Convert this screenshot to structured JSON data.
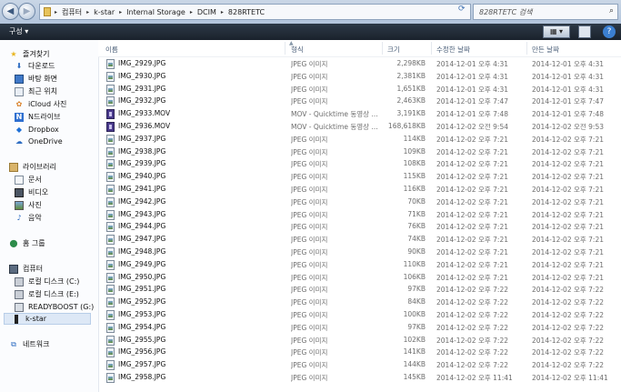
{
  "window": {
    "breadcrumbs": [
      "컴퓨터",
      "k-star",
      "Internal Storage",
      "DCIM",
      "828RTETC"
    ],
    "search_placeholder": "828RTETC 검색"
  },
  "toolbar": {
    "organize_label": "구성 ▾"
  },
  "nav": {
    "favorites": {
      "label": "즐겨찾기",
      "items": [
        "다운로드",
        "바탕 화면",
        "최근 위치",
        "iCloud 사진",
        "N드라이브",
        "Dropbox",
        "OneDrive"
      ]
    },
    "libraries": {
      "label": "라이브러리",
      "items": [
        "문서",
        "비디오",
        "사진",
        "음악"
      ]
    },
    "homegroup": "홈 그룹",
    "computer": {
      "label": "컴퓨터",
      "items": [
        "로컬 디스크 (C:)",
        "로컬 디스크 (E:)",
        "READYBOOST (G:)",
        "k-star"
      ]
    },
    "network": "네트워크"
  },
  "columns": {
    "name": "이름",
    "type": "형식",
    "size": "크기",
    "modified": "수정한 날짜",
    "created": "만든 날짜"
  },
  "files": [
    {
      "name": "IMG_2929.JPG",
      "type": "JPEG 이미지",
      "size": "2,298KB",
      "modified": "2014-12-01 오후 4:31",
      "created": "2014-12-01 오후 4:31",
      "kind": "jpg"
    },
    {
      "name": "IMG_2930.JPG",
      "type": "JPEG 이미지",
      "size": "2,381KB",
      "modified": "2014-12-01 오후 4:31",
      "created": "2014-12-01 오후 4:31",
      "kind": "jpg"
    },
    {
      "name": "IMG_2931.JPG",
      "type": "JPEG 이미지",
      "size": "1,651KB",
      "modified": "2014-12-01 오후 4:31",
      "created": "2014-12-01 오후 4:31",
      "kind": "jpg"
    },
    {
      "name": "IMG_2932.JPG",
      "type": "JPEG 이미지",
      "size": "2,463KB",
      "modified": "2014-12-01 오후 7:47",
      "created": "2014-12-01 오후 7:47",
      "kind": "jpg"
    },
    {
      "name": "IMG_2933.MOV",
      "type": "MOV - Quicktime 동영상 ...",
      "size": "3,191KB",
      "modified": "2014-12-01 오후 7:48",
      "created": "2014-12-01 오후 7:48",
      "kind": "mov"
    },
    {
      "name": "IMG_2936.MOV",
      "type": "MOV - Quicktime 동영상 ...",
      "size": "168,618KB",
      "modified": "2014-12-02 오전 9:54",
      "created": "2014-12-02 오전 9:53",
      "kind": "mov"
    },
    {
      "name": "IMG_2937.JPG",
      "type": "JPEG 이미지",
      "size": "114KB",
      "modified": "2014-12-02 오후 7:21",
      "created": "2014-12-02 오후 7:21",
      "kind": "jpg"
    },
    {
      "name": "IMG_2938.JPG",
      "type": "JPEG 이미지",
      "size": "109KB",
      "modified": "2014-12-02 오후 7:21",
      "created": "2014-12-02 오후 7:21",
      "kind": "jpg"
    },
    {
      "name": "IMG_2939.JPG",
      "type": "JPEG 이미지",
      "size": "108KB",
      "modified": "2014-12-02 오후 7:21",
      "created": "2014-12-02 오후 7:21",
      "kind": "jpg"
    },
    {
      "name": "IMG_2940.JPG",
      "type": "JPEG 이미지",
      "size": "115KB",
      "modified": "2014-12-02 오후 7:21",
      "created": "2014-12-02 오후 7:21",
      "kind": "jpg"
    },
    {
      "name": "IMG_2941.JPG",
      "type": "JPEG 이미지",
      "size": "116KB",
      "modified": "2014-12-02 오후 7:21",
      "created": "2014-12-02 오후 7:21",
      "kind": "jpg"
    },
    {
      "name": "IMG_2942.JPG",
      "type": "JPEG 이미지",
      "size": "70KB",
      "modified": "2014-12-02 오후 7:21",
      "created": "2014-12-02 오후 7:21",
      "kind": "jpg"
    },
    {
      "name": "IMG_2943.JPG",
      "type": "JPEG 이미지",
      "size": "71KB",
      "modified": "2014-12-02 오후 7:21",
      "created": "2014-12-02 오후 7:21",
      "kind": "jpg"
    },
    {
      "name": "IMG_2944.JPG",
      "type": "JPEG 이미지",
      "size": "76KB",
      "modified": "2014-12-02 오후 7:21",
      "created": "2014-12-02 오후 7:21",
      "kind": "jpg"
    },
    {
      "name": "IMG_2947.JPG",
      "type": "JPEG 이미지",
      "size": "74KB",
      "modified": "2014-12-02 오후 7:21",
      "created": "2014-12-02 오후 7:21",
      "kind": "jpg"
    },
    {
      "name": "IMG_2948.JPG",
      "type": "JPEG 이미지",
      "size": "90KB",
      "modified": "2014-12-02 오후 7:21",
      "created": "2014-12-02 오후 7:21",
      "kind": "jpg"
    },
    {
      "name": "IMG_2949.JPG",
      "type": "JPEG 이미지",
      "size": "110KB",
      "modified": "2014-12-02 오후 7:21",
      "created": "2014-12-02 오후 7:21",
      "kind": "jpg"
    },
    {
      "name": "IMG_2950.JPG",
      "type": "JPEG 이미지",
      "size": "106KB",
      "modified": "2014-12-02 오후 7:21",
      "created": "2014-12-02 오후 7:21",
      "kind": "jpg"
    },
    {
      "name": "IMG_2951.JPG",
      "type": "JPEG 이미지",
      "size": "97KB",
      "modified": "2014-12-02 오후 7:22",
      "created": "2014-12-02 오후 7:22",
      "kind": "jpg"
    },
    {
      "name": "IMG_2952.JPG",
      "type": "JPEG 이미지",
      "size": "84KB",
      "modified": "2014-12-02 오후 7:22",
      "created": "2014-12-02 오후 7:22",
      "kind": "jpg"
    },
    {
      "name": "IMG_2953.JPG",
      "type": "JPEG 이미지",
      "size": "100KB",
      "modified": "2014-12-02 오후 7:22",
      "created": "2014-12-02 오후 7:22",
      "kind": "jpg"
    },
    {
      "name": "IMG_2954.JPG",
      "type": "JPEG 이미지",
      "size": "97KB",
      "modified": "2014-12-02 오후 7:22",
      "created": "2014-12-02 오후 7:22",
      "kind": "jpg"
    },
    {
      "name": "IMG_2955.JPG",
      "type": "JPEG 이미지",
      "size": "102KB",
      "modified": "2014-12-02 오후 7:22",
      "created": "2014-12-02 오후 7:22",
      "kind": "jpg"
    },
    {
      "name": "IMG_2956.JPG",
      "type": "JPEG 이미지",
      "size": "141KB",
      "modified": "2014-12-02 오후 7:22",
      "created": "2014-12-02 오후 7:22",
      "kind": "jpg"
    },
    {
      "name": "IMG_2957.JPG",
      "type": "JPEG 이미지",
      "size": "144KB",
      "modified": "2014-12-02 오후 7:22",
      "created": "2014-12-02 오후 7:22",
      "kind": "jpg"
    },
    {
      "name": "IMG_2958.JPG",
      "type": "JPEG 이미지",
      "size": "145KB",
      "modified": "2014-12-02 오후 11:41",
      "created": "2014-12-02 오후 11:41",
      "kind": "jpg"
    }
  ]
}
